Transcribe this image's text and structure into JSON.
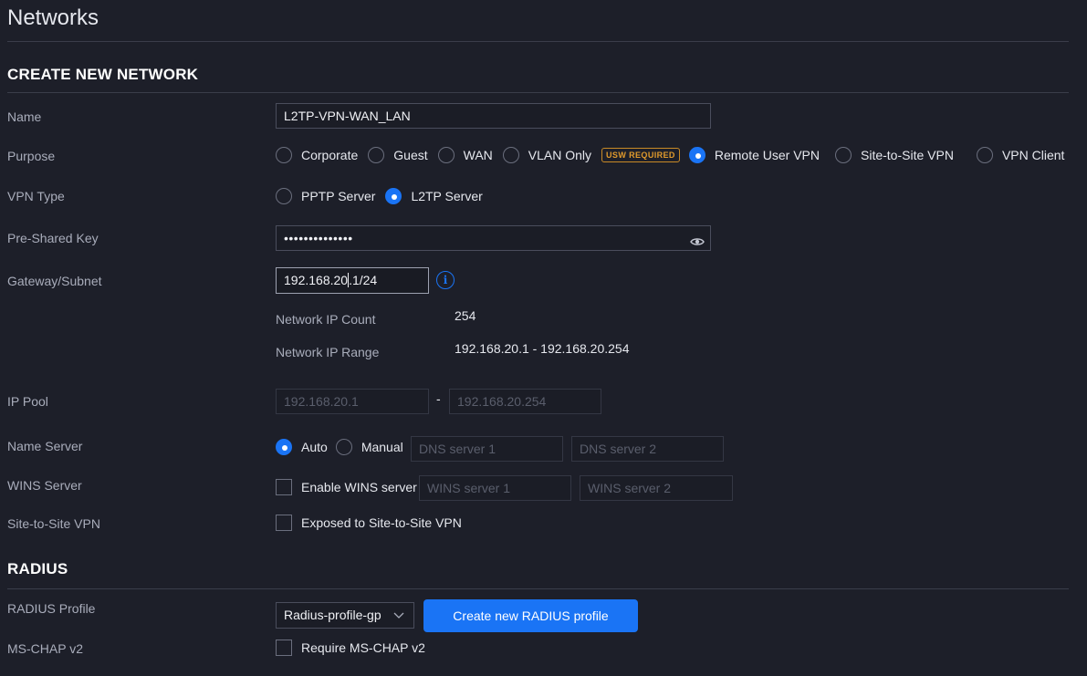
{
  "page": {
    "title": "Networks"
  },
  "create_section": {
    "title": "CREATE NEW NETWORK"
  },
  "name": {
    "label": "Name",
    "value": "L2TP-VPN-WAN_LAN"
  },
  "purpose": {
    "label": "Purpose",
    "options": [
      "Corporate",
      "Guest",
      "WAN",
      "VLAN Only",
      "Remote User VPN",
      "Site-to-Site VPN",
      "VPN Client"
    ],
    "selected": "Remote User VPN",
    "badge": "USW REQUIRED"
  },
  "vpn_type": {
    "label": "VPN Type",
    "options": [
      "PPTP Server",
      "L2TP Server"
    ],
    "selected": "L2TP Server"
  },
  "psk": {
    "label": "Pre-Shared Key",
    "masked_value": "••••••••••••••"
  },
  "gateway": {
    "label": "Gateway/Subnet",
    "value_before_cursor": "192.168.20",
    "value_after_cursor": ".1/24",
    "info_glyph": "i",
    "ip_count_label": "Network IP Count",
    "ip_count": "254",
    "ip_range_label": "Network IP Range",
    "ip_range": "192.168.20.1 - 192.168.20.254"
  },
  "ip_pool": {
    "label": "IP Pool",
    "start": "192.168.20.1",
    "separator": "-",
    "end": "192.168.20.254"
  },
  "name_server": {
    "label": "Name Server",
    "options": [
      "Auto",
      "Manual"
    ],
    "selected": "Auto",
    "dns1_placeholder": "DNS server 1",
    "dns2_placeholder": "DNS server 2"
  },
  "wins": {
    "label": "WINS Server",
    "checkbox_label": "Enable WINS server",
    "wins1_placeholder": "WINS server 1",
    "wins2_placeholder": "WINS server 2"
  },
  "site_to_site": {
    "label": "Site-to-Site VPN",
    "checkbox_label": "Exposed to Site-to-Site VPN"
  },
  "radius_section": {
    "title": "RADIUS"
  },
  "radius_profile": {
    "label": "RADIUS Profile",
    "selected": "Radius-profile-gp",
    "create_button": "Create new RADIUS profile"
  },
  "mschap": {
    "label": "MS-CHAP v2",
    "checkbox_label": "Require MS-CHAP v2"
  },
  "colors": {
    "background": "#1d1f29",
    "accent": "#1a74f5",
    "badge": "#e09a2c"
  },
  "icons": {
    "password": "eye-icon",
    "info": "info-icon",
    "select": "chevron-down-icon"
  }
}
